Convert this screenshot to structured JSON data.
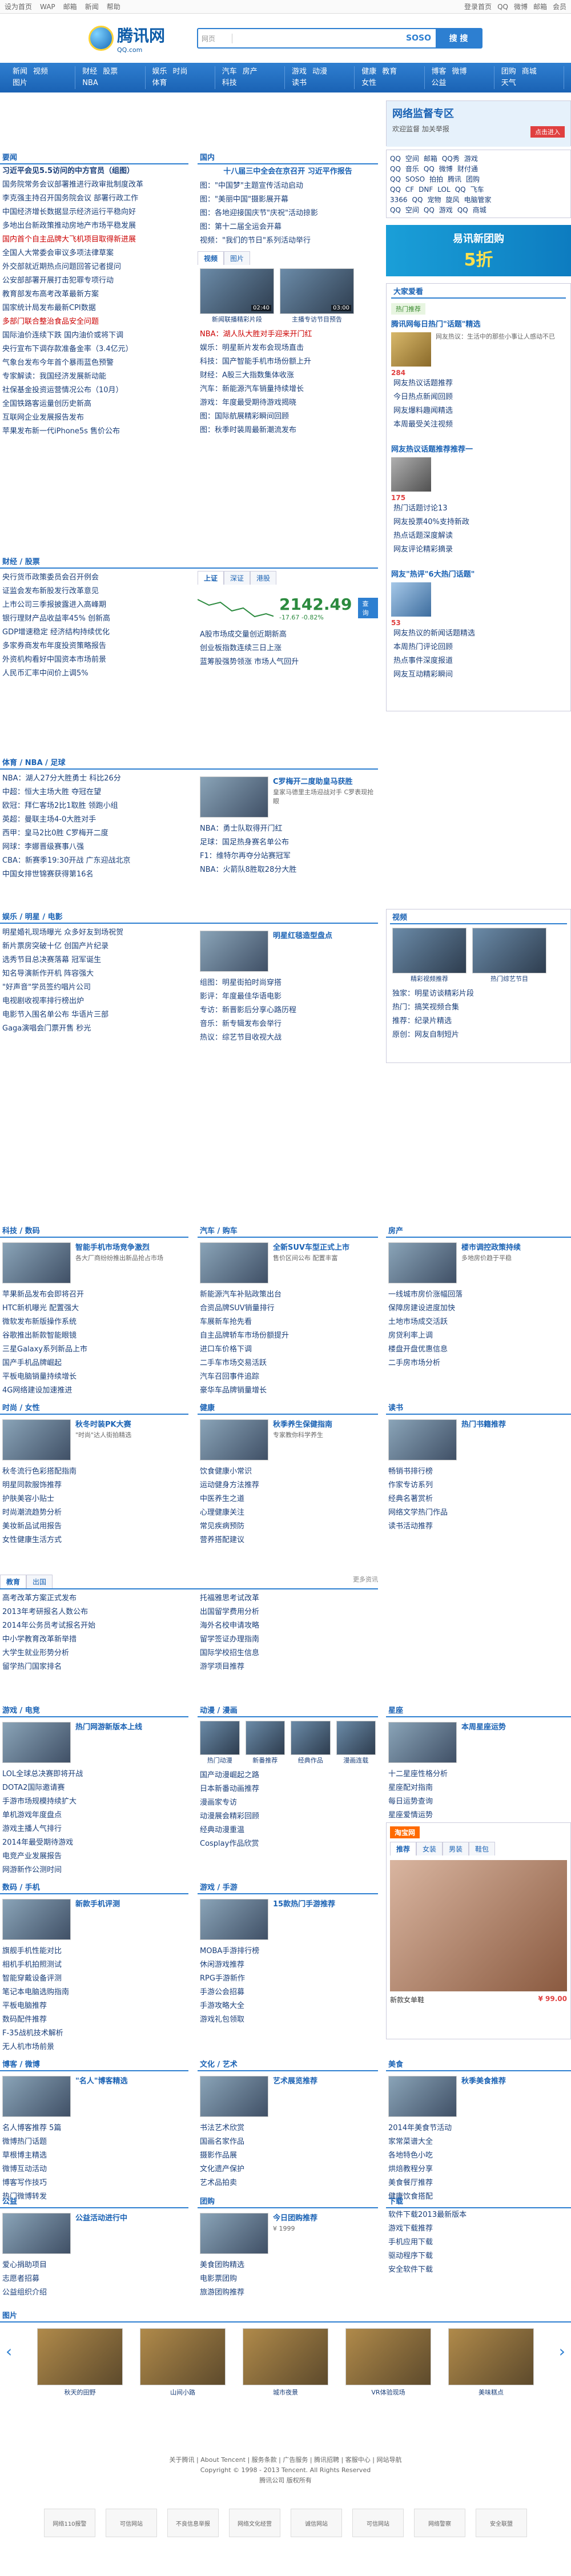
{
  "topbar": {
    "left": [
      "设为首页",
      "WAP",
      "邮箱",
      "新闻",
      "帮助"
    ],
    "right": [
      "登录首页",
      "QQ",
      "微博",
      "邮箱",
      "会员"
    ]
  },
  "header": {
    "logo_text": "腾讯网",
    "logo_sub": "QQ.com",
    "search_select": "网页",
    "search_placeholder": "",
    "sogo_label": "SOSO",
    "search_button": "搜 搜"
  },
  "nav": [
    [
      "新闻",
      "视频",
      "图片"
    ],
    [
      "财经",
      "股票",
      "NBA"
    ],
    [
      "娱乐",
      "时尚",
      "体育"
    ],
    [
      "汽车",
      "房产",
      "科技"
    ],
    [
      "游戏",
      "动漫",
      "读书"
    ],
    [
      "健康",
      "教育",
      "女性"
    ],
    [
      "博客",
      "微博",
      "公益"
    ],
    [
      "团购",
      "商城",
      "天气"
    ]
  ],
  "right_promo": {
    "title": "网络监督专区",
    "sub": "欢迎监督  加关举报",
    "badge": "点击进入"
  },
  "left_news": {
    "title": "要闻",
    "items": [
      {
        "t": "习近平会见5.5访问的中方官员（组图）",
        "c": "bold"
      },
      {
        "t": "国务院常务会议部署推进行政审批制度改革",
        "c": ""
      },
      {
        "t": "李克强主持召开国务院会议 部署行政工作",
        "c": ""
      },
      {
        "t": "中国经济增长数据显示经济运行平稳向好",
        "c": ""
      },
      {
        "t": "多地出台新政策推动房地产市场平稳发展",
        "c": ""
      },
      {
        "t": "国内首个自主品牌大飞机项目取得新进展",
        "c": "red"
      },
      {
        "t": "全国人大常委会审议多项法律草案",
        "c": ""
      },
      {
        "t": "外交部就近期热点问题回答记者提问",
        "c": ""
      },
      {
        "t": "公安部部署开展打击犯罪专项行动",
        "c": ""
      },
      {
        "t": "教育部发布高考改革最新方案",
        "c": ""
      },
      {
        "t": "国家统计局发布最新CPI数据",
        "c": ""
      },
      {
        "t": "多部门联合整治食品安全问题",
        "c": "red"
      },
      {
        "t": "国际油价连续下跌 国内油价或将下调",
        "c": ""
      },
      {
        "t": "央行宣布下调存款准备金率（3.4亿元）",
        "c": ""
      },
      {
        "t": "气象台发布今年首个暴雨蓝色预警",
        "c": ""
      },
      {
        "t": "专家解读：我国经济发展新动能",
        "c": ""
      },
      {
        "t": "社保基金投资运营情况公布（10月）",
        "c": ""
      },
      {
        "t": "全国铁路客运量创历史新高",
        "c": ""
      },
      {
        "t": "互联网企业发展报告发布",
        "c": ""
      },
      {
        "t": "苹果发布新一代iPhone5s 售价公布",
        "c": ""
      }
    ]
  },
  "mid_news": {
    "title": "国内",
    "headline": "十八届三中全会在京召开 习近平作报告",
    "items": [
      "图：\"中国梦\"主题宣传活动启动",
      "图：\"美丽中国\"摄影展开幕",
      "图：各地迎接国庆节\"庆祝\"活动掠影",
      "图：第十二届全运会开幕",
      "视频：\"我们的节日\"系列活动举行"
    ],
    "tabs": [
      "视频",
      "图片"
    ],
    "thumbs": [
      {
        "cap": "新闻联播精彩片段",
        "dur": "02:40"
      },
      {
        "cap": "主播专访节目预告",
        "dur": "03:00"
      }
    ],
    "more": [
      {
        "t": "NBA：湖人队大胜对手迎来开门红",
        "c": "red"
      },
      {
        "t": "娱乐：明星新片发布会现场直击",
        "c": ""
      },
      {
        "t": "科技：国产智能手机市场份额上升",
        "c": ""
      },
      {
        "t": "财经：A股三大指数集体收涨",
        "c": ""
      },
      {
        "t": "汽车：新能源汽车销量持续增长",
        "c": ""
      },
      {
        "t": "游戏：年度最受期待游戏揭晓",
        "c": ""
      },
      {
        "t": "图：国际航展精彩瞬间回顾",
        "c": ""
      },
      {
        "t": "图：秋季时装周最新潮流发布",
        "c": ""
      }
    ]
  },
  "right_links": {
    "rows": [
      [
        "QQ",
        "空间",
        "邮箱",
        "QQ秀",
        "游戏"
      ],
      [
        "QQ",
        "音乐",
        "QQ",
        "微博",
        "财付通"
      ],
      [
        "QQ",
        "SOSO",
        "拍拍",
        "腾讯",
        "团购"
      ],
      [
        "QQ",
        "CF",
        "DNF",
        "LOL",
        "QQ",
        "飞车"
      ],
      [
        "3366",
        "QQ",
        "宠物",
        "旋风",
        "电脑管家"
      ],
      [
        "QQ",
        "空间",
        "QQ",
        "游戏",
        "QQ",
        "商城"
      ]
    ]
  },
  "tuan": {
    "title": "易讯新团购",
    "sub": "拍便宜",
    "discount": "5折"
  },
  "dajia": {
    "title": "大家爱看",
    "tag": "热门推荐",
    "lead": "腾讯网每日热门\"话题\"精选",
    "desc": "网友热议：生活中的那些小事让人感动不已",
    "count1": "284",
    "items1": [
      "网友热议话题推荐",
      "今日热点新闻回顾",
      "网友爆料趣闻精选",
      "本周最受关注视频"
    ],
    "lead2": "网友热议话题推荐推荐一",
    "count2": "175",
    "items2": [
      "热门话题讨论13",
      "网友投票40%支持新政",
      "热点话题深度解读",
      "网友评论精彩摘录"
    ],
    "lead3": "网友\"热评\"6大热门话题\"",
    "count3": "53",
    "items3": [
      "网友热议的新闻话题精选",
      "本周热门评论回顾",
      "热点事件深度报道",
      "网友互动精彩瞬间"
    ]
  },
  "finance": {
    "title": "财经 / 股票",
    "tabs": [
      "上证",
      "深证",
      "港股"
    ],
    "index": "2142.49",
    "change": "-17.67",
    "pct": "-0.82%",
    "search_label": "查询",
    "items": [
      "央行货币政策委员会召开例会",
      "证监会发布新股发行改革意见",
      "上市公司三季报披露进入高峰期",
      "银行理财产品收益率45%  创新高",
      "GDP增速稳定 经济结构持续优化",
      "多家券商发布年度投资策略报告",
      "外资机构看好中国资本市场前景",
      "人民币汇率中间价上调5%"
    ],
    "right_items": [
      "A股市场成交量创近期新高",
      "创业板指数连续三日上涨",
      "蓝筹股强势领涨 市场人气回升"
    ]
  },
  "sports": {
    "title": "体育 / NBA / 足球",
    "items": [
      "NBA：湖人27分大胜勇士 科比26分",
      "中超：恒大主场大胜 夺冠在望",
      "欧冠：拜仁客场2比1取胜 领跑小组",
      "英超：曼联主场4-0大胜对手",
      "西甲：皇马2比0胜 C罗梅开二度",
      "网球：李娜晋级赛事八强",
      "CBA：新赛季19:30开战 广东迎战北京",
      "中国女排世锦赛获得第16名"
    ],
    "feat_title": "C罗梅开二度助皇马获胜",
    "feat_desc": "皇家马德里主场迎战对手 C罗表现抢眼",
    "right_items": [
      "NBA：勇士队取得开门红",
      "足球：国足热身赛名单公布",
      "F1：维特尔再夺分站赛冠军",
      "NBA：火箭队8胜取28分大胜"
    ]
  },
  "ent": {
    "title": "娱乐 / 明星 / 电影",
    "items": [
      "明星婚礼现场曝光 众多好友到场祝贺",
      "新片票房突破十亿 创国产片纪录",
      "选秀节目总决赛落幕 冠军诞生",
      "知名导演新作开机 阵容强大",
      "\"好声音\"学员签约唱片公司",
      "电视剧收视率排行榜出炉",
      "电影节入围名单公布 华语片三部",
      "Gaga演唱会门票开售 秒光"
    ],
    "feat_title": "明星红毯造型盘点",
    "right_items": [
      "组图：明星街拍时尚穿搭",
      "影评：年度最佳华语电影",
      "专访：新晋影后分享心路历程",
      "音乐：新专辑发布会举行",
      "热议：综艺节目收视大战"
    ]
  },
  "video_side": {
    "title": "视频",
    "thumbs": [
      "精彩视频推荐",
      "热门综艺节目"
    ],
    "items": [
      "独家：明星访谈精彩片段",
      "热门：搞笑视频合集",
      "推荐：纪录片精选",
      "原创：网友自制短片"
    ]
  },
  "row2": [
    {
      "title": "科技 / 数码",
      "feat": "智能手机市场竞争激烈",
      "feat_desc": "各大厂商纷纷推出新品抢占市场",
      "items": [
        "苹果新品发布会即将召开",
        "HTC新机曝光 配置强大",
        "微软发布新版操作系统",
        "谷歌推出新款智能眼镜",
        "三星Galaxy系列新品上市",
        "国产手机品牌崛起",
        "平板电脑销量持续增长",
        "4G网络建设加速推进"
      ]
    },
    {
      "title": "汽车 / 购车",
      "feat": "全新SUV车型正式上市",
      "feat_desc": "售价区间公布 配置丰富",
      "items": [
        "新能源汽车补贴政策出台",
        "合资品牌SUV销量排行",
        "车展新车抢先看",
        "自主品牌轿车市场份额提升",
        "进口车价格下调",
        "二手车市场交易活跃",
        "汽车召回事件追踪",
        "豪华车品牌销量增长"
      ]
    },
    {
      "title": "房产",
      "feat": "楼市调控政策持续",
      "feat_desc": "多地房价趋于平稳",
      "items": [
        "一线城市房价涨幅回落",
        "保障房建设进度加快",
        "土地市场成交活跃",
        "房贷利率上调",
        "楼盘开盘优惠信息",
        "二手房市场分析"
      ]
    }
  ],
  "row3": [
    {
      "title": "时尚 / 女性",
      "feat": "秋冬时装PK大赛",
      "feat_desc": "\"时尚\"达人街拍精选",
      "items": [
        "秋冬流行色彩搭配指南",
        "明星同款服饰推荐",
        "护肤美容小贴士",
        "时尚潮流趋势分析",
        "美妆新品试用报告",
        "女性健康生活方式"
      ]
    },
    {
      "title": "健康",
      "feat": "秋季养生保健指南",
      "feat_desc": "专家教你科学养生",
      "items": [
        "饮食健康小常识",
        "运动健身方法推荐",
        "中医养生之道",
        "心理健康关注",
        "常见疾病预防",
        "营养搭配建议"
      ]
    },
    {
      "title": "读书",
      "feat": "热门书籍推荐",
      "feat_desc": "",
      "items": [
        "畅销书排行榜",
        "作家专访系列",
        "经典名著赏析",
        "网络文学热门作品",
        "读书活动推荐"
      ]
    }
  ],
  "row4": {
    "tabs": [
      "教育",
      "出国"
    ],
    "more": "更多资讯",
    "left": [
      "高考改革方案正式发布",
      "2013年考研报名人数公布",
      "2014年公务员考试报名开始",
      "中小学教育改革新举措",
      "大学生就业形势分析",
      "留学热门国家排名"
    ],
    "right": [
      "托福雅思考试改革",
      "出国留学费用分析",
      "海外名校申请攻略",
      "留学签证办理指南",
      "国际学校招生信息",
      "游学项目推荐"
    ]
  },
  "row5": [
    {
      "title": "游戏 / 电竞",
      "feat": "热门网游新版本上线",
      "items": [
        "LOL全球总决赛即将开战",
        "DOTA2国际邀请赛",
        "手游市场规模持续扩大",
        "单机游戏年度盘点",
        "游戏主播人气排行",
        "2014年最受期待游戏",
        "电竞产业发展报告",
        "网游新作公测时间"
      ]
    },
    {
      "title": "动漫 / 漫画",
      "thumbs": [
        "热门动漫",
        "新番推荐",
        "经典作品",
        "漫画连载"
      ],
      "items": [
        "国产动漫崛起之路",
        "日本新番动画推荐",
        "漫画家专访",
        "动漫展会精彩回顾",
        "经典动漫重温",
        "Cosplay作品欣赏"
      ]
    },
    {
      "title": "星座",
      "feat": "本周星座运势",
      "items": [
        "十二星座性格分析",
        "星座配对指南",
        "每日运势查询",
        "星座爱情运势",
        "星座职场运势"
      ]
    }
  ],
  "row6": [
    {
      "title": "数码 / 手机",
      "feat": "新款手机评测",
      "items": [
        "旗舰手机性能对比",
        "相机手机拍照测试",
        "智能穿戴设备评测",
        "笔记本电脑选购指南",
        "平板电脑推荐",
        "数码配件推荐",
        "F-35战机技术解析",
        "无人机市场前景"
      ]
    },
    {
      "title": "游戏 / 手游",
      "feat": "15款热门手游推荐",
      "items": [
        "MOBA手游排行榜",
        "休闲游戏推荐",
        "RPG手游新作",
        "手游公会招募",
        "手游攻略大全",
        "游戏礼包领取"
      ]
    }
  ],
  "shop": {
    "title": "淘宝网",
    "tabs": [
      "推荐",
      "女装",
      "男装",
      "鞋包"
    ],
    "name": "新款女单鞋",
    "price": "¥ 99.00"
  },
  "row7": [
    {
      "title": "博客 / 微博",
      "feat": "\"名人\"博客精选",
      "items": [
        "名人博客推荐 5篇",
        "微博热门话题",
        "草根博主精选",
        "微博互动活动",
        "博客写作技巧",
        "热门微博转发"
      ]
    },
    {
      "title": "文化 / 艺术",
      "feat": "艺术展览推荐",
      "items": [
        "书法艺术欣赏",
        "国画名家作品",
        "摄影作品展",
        "文化遗产保护",
        "艺术品拍卖"
      ]
    },
    {
      "title": "美食",
      "feat": "秋季美食推荐",
      "items": [
        "2014年美食节活动",
        "家常菜谱大全",
        "各地特色小吃",
        "烘焙教程分享",
        "美食餐厅推荐",
        "健康饮食搭配"
      ]
    }
  ],
  "row8": [
    {
      "title": "公益",
      "feat": "公益活动进行中",
      "items": [
        "爱心捐助项目",
        "志愿者招募",
        "公益组织介绍"
      ]
    },
    {
      "title": "团购",
      "feat": "今日团购推荐",
      "price": "¥ 1999",
      "items": [
        "美食团购精选",
        "电影票团购",
        "旅游团购推荐"
      ]
    },
    {
      "title": "下载",
      "items": [
        "软件下载2013最新版本",
        "游戏下载推荐",
        "手机应用下载",
        "驱动程序下载",
        "安全软件下载"
      ]
    }
  ],
  "gallery": {
    "title": "图片",
    "items": [
      "秋天的田野",
      "山间小路",
      "城市夜景",
      "VR体验现场",
      "美味糕点"
    ]
  },
  "footer": {
    "links": "关于腾讯 | About Tencent | 服务条款 | 广告服务 | 腾讯招聘 | 客服中心 | 网站导航",
    "line2": "Copyright © 1998 - 2013 Tencent. All Rights Reserved",
    "line3": "腾讯公司 版权所有",
    "badges": [
      "网络110报警",
      "可信网站",
      "不良信息举报",
      "网络文化经营",
      "诚信网站",
      "可信网站",
      "网络警察",
      "安全联盟"
    ]
  }
}
